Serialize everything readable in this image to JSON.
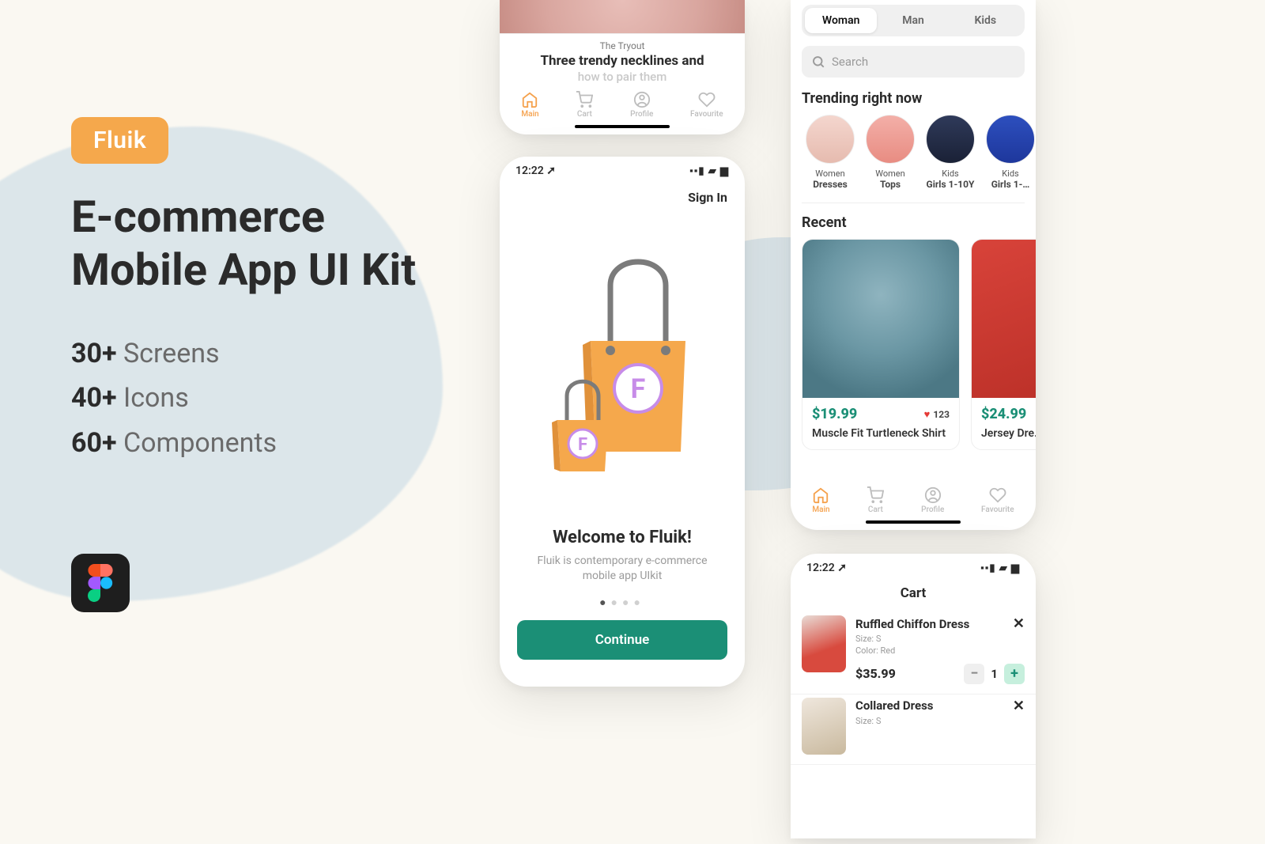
{
  "marketing": {
    "badge": "Fluik",
    "headline_line1": "E-commerce",
    "headline_line2": "Mobile App UI Kit",
    "stats": {
      "screens_num": "30+",
      "screens_label": "Screens",
      "icons_num": "40+",
      "icons_label": "Icons",
      "components_num": "60+",
      "components_label": "Components"
    }
  },
  "phoneA": {
    "eyebrow": "The Tryout",
    "title": "Three trendy necklines and",
    "subtitle": "how to pair them",
    "tabs": {
      "main": "Main",
      "cart": "Cart",
      "profile": "Profile",
      "favourite": "Favourite"
    }
  },
  "phoneB": {
    "time": "12:22",
    "signin": "Sign In",
    "welcome_title": "Welcome to Fluik!",
    "welcome_sub": "Fluik is contemporary e-commerce mobile app UIkit",
    "cta": "Continue"
  },
  "phoneC": {
    "segments": {
      "woman": "Woman",
      "man": "Man",
      "kids": "Kids"
    },
    "search_placeholder": "Search",
    "trending_title": "Trending right now",
    "trending": [
      {
        "cat": "Women",
        "name": "Dresses"
      },
      {
        "cat": "Women",
        "name": "Tops"
      },
      {
        "cat": "Kids",
        "name": "Girls 1-10Y"
      },
      {
        "cat": "Kids",
        "name": "Girls 1-…"
      }
    ],
    "recent_title": "Recent",
    "recent": [
      {
        "price": "$19.99",
        "likes": "123",
        "name": "Muscle Fit Turtleneck Shirt"
      },
      {
        "price": "$24.99",
        "name": "Jersey Dre…"
      }
    ],
    "tabs": {
      "main": "Main",
      "cart": "Cart",
      "profile": "Profile",
      "favourite": "Favourite"
    }
  },
  "phoneD": {
    "time": "12:22",
    "title": "Cart",
    "items": [
      {
        "name": "Ruffled Chiffon Dress",
        "size_label": "Size:",
        "size": "S",
        "color_label": "Color:",
        "color": "Red",
        "price": "$35.99",
        "qty": "1"
      },
      {
        "name": "Collared Dress",
        "size_label": "Size:",
        "size": "S"
      }
    ]
  }
}
